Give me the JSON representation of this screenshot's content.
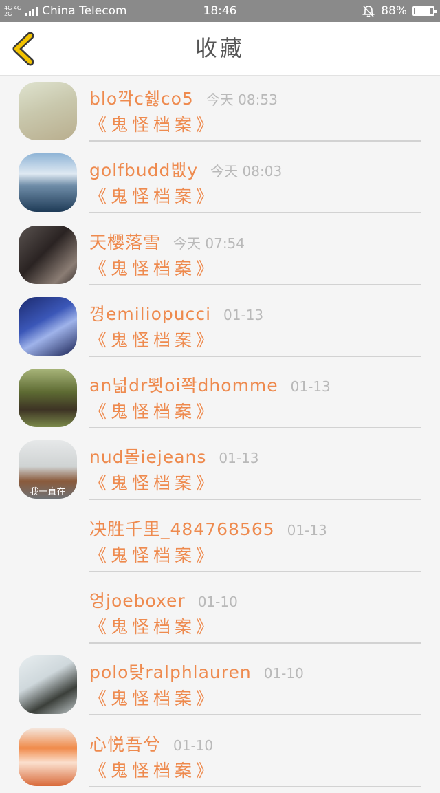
{
  "status_bar": {
    "net_top": "4G 4G",
    "net_bottom": "2G",
    "carrier": "China Telecom",
    "time": "18:46",
    "battery": "88%",
    "battery_level": 0.88
  },
  "header": {
    "back_icon": "chevron-left-icon",
    "title": "收藏",
    "accent": "#f2c200"
  },
  "colors": {
    "name": "#ee8a4e",
    "time": "#b9b9b9"
  },
  "favorites": [
    {
      "name": "blo깍c쉟co5",
      "time": "今天 08:53",
      "book": "《鬼怪档案》",
      "avatar": "foggy-figure-avatar",
      "has_avatar": true
    },
    {
      "name": "golfbudd뱂y",
      "time": "今天 08:03",
      "book": "《鬼怪档案》",
      "avatar": "sky-sea-avatar",
      "has_avatar": true
    },
    {
      "name": "天樱落雪",
      "time": "今天 07:54",
      "book": "《鬼怪档案》",
      "avatar": "dark-girl-avatar",
      "has_avatar": true
    },
    {
      "name": "꼉emiliopucci",
      "time": "01-13",
      "book": "《鬼怪档案》",
      "avatar": "anime-boy-avatar",
      "has_avatar": true
    },
    {
      "name": "an넒dr뾧oi쫙dhomme",
      "time": "01-13",
      "book": "《鬼怪档案》",
      "avatar": "field-girl-avatar",
      "has_avatar": true
    },
    {
      "name": "nud몰iejeans",
      "time": "01-13",
      "book": "《鬼怪档案》",
      "avatar": "girl-back-avatar",
      "avatar_caption": "我一直在",
      "has_avatar": true
    },
    {
      "name": "决胜千里_484768565",
      "time": "01-13",
      "book": "《鬼怪档案》",
      "has_avatar": false
    },
    {
      "name": "엉joeboxer",
      "time": "01-10",
      "book": "《鬼怪档案》",
      "has_avatar": false
    },
    {
      "name": "polo탖ralphlauren",
      "time": "01-10",
      "book": "《鬼怪档案》",
      "avatar": "headphones-avatar",
      "has_avatar": true
    },
    {
      "name": "心悦吾兮",
      "time": "01-10",
      "book": "《鬼怪档案》",
      "avatar": "anime-girl-avatar",
      "has_avatar": true
    }
  ]
}
